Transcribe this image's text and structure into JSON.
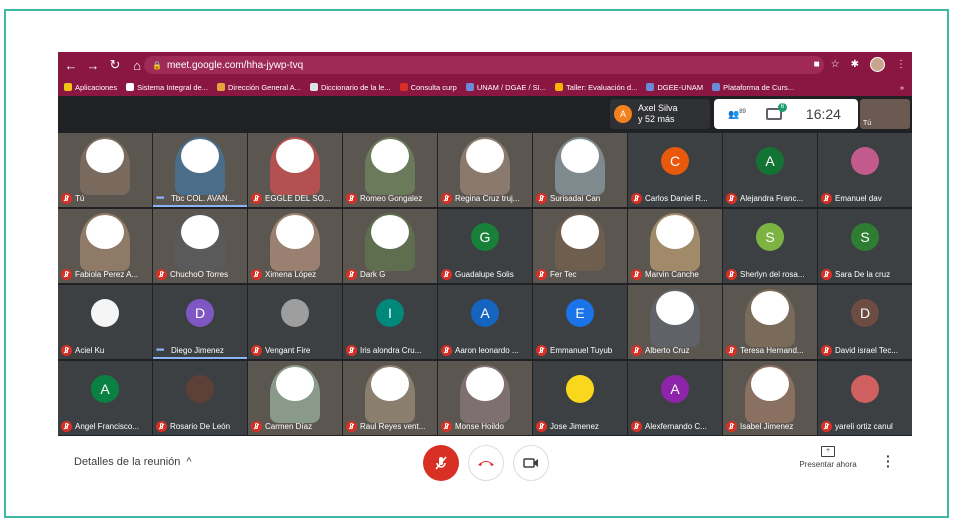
{
  "browser": {
    "url": "meet.google.com/hha-jywp-tvq",
    "bookmarks": [
      {
        "label": "Aplicaciones",
        "color": "#f0c419"
      },
      {
        "label": "Sistema Integral de...",
        "color": "#ffffff"
      },
      {
        "label": "Dirección General A...",
        "color": "#e8a33d"
      },
      {
        "label": "Diccionario de la le...",
        "color": "#e0e0e0"
      },
      {
        "label": "Consulta curp",
        "color": "#d93025"
      },
      {
        "label": "UNAM / DGAE / SI...",
        "color": "#6b8bd6"
      },
      {
        "label": "Taller: Evaluación d...",
        "color": "#f7b500"
      },
      {
        "label": "DGEE-UNAM",
        "color": "#6b8bd6"
      },
      {
        "label": "Plataforma de Curs...",
        "color": "#6b8bd6"
      }
    ],
    "more": "»"
  },
  "meet": {
    "host_avatar": "A",
    "host_name": "Axel Silva",
    "host_more": "y 52 más",
    "people_count": "89",
    "chat_badge": "6",
    "time": "16:24",
    "self_label": "Tú"
  },
  "participants": [
    {
      "name": "Tú",
      "kind": "video",
      "color": "#7a6a5e"
    },
    {
      "name": "Tbc COL. AVAN...",
      "kind": "video",
      "color": "#4a6e8a",
      "speaking": true
    },
    {
      "name": "EGGLE DEL SO...",
      "kind": "video",
      "color": "#b35050"
    },
    {
      "name": "Romeo Gongalez",
      "kind": "video",
      "color": "#6a7a5a"
    },
    {
      "name": "Regina Cruz truj...",
      "kind": "video",
      "color": "#8a7a6e"
    },
    {
      "name": "Surisadai Can",
      "kind": "video",
      "color": "#7e8a8e"
    },
    {
      "name": "Carlos Daniel R...",
      "kind": "initial",
      "initial": "C",
      "color": "#e8590c"
    },
    {
      "name": "Alejandra Franc...",
      "kind": "initial",
      "initial": "A",
      "color": "#137333"
    },
    {
      "name": "Emanuel dav",
      "kind": "pic",
      "color": "#c25a8c"
    },
    {
      "name": "Fabiola Perez A...",
      "kind": "video",
      "color": "#8e7a66"
    },
    {
      "name": "ChuchoO Torres",
      "kind": "video",
      "color": "#5a5a5a"
    },
    {
      "name": "Ximena López",
      "kind": "video",
      "color": "#9a8070"
    },
    {
      "name": "Dark G",
      "kind": "video",
      "color": "#5e6e4e"
    },
    {
      "name": "Guadalupe Solis",
      "kind": "initial",
      "initial": "G",
      "color": "#188038"
    },
    {
      "name": "Fer Tec",
      "kind": "video",
      "color": "#6e5e4e"
    },
    {
      "name": "Marvin Canche",
      "kind": "video",
      "color": "#a08a6a"
    },
    {
      "name": "Sherlyn del rosa...",
      "kind": "initial",
      "initial": "S",
      "color": "#7cb342"
    },
    {
      "name": "Sara De la cruz",
      "kind": "initial",
      "initial": "S",
      "color": "#2e7d32"
    },
    {
      "name": "Aciel Ku",
      "kind": "pic",
      "color": "#f5f5f5"
    },
    {
      "name": "Diego Jimenez",
      "kind": "initial",
      "initial": "D",
      "color": "#7e57c2",
      "speaking": true
    },
    {
      "name": "Vengant Fire",
      "kind": "pic",
      "color": "#9e9e9e"
    },
    {
      "name": "Iris alondra Cru...",
      "kind": "initial",
      "initial": "I",
      "color": "#00897b"
    },
    {
      "name": "Aaron leonardo ...",
      "kind": "initial",
      "initial": "A",
      "color": "#1565c0"
    },
    {
      "name": "Emmanuel Tuyub",
      "kind": "initial",
      "initial": "E",
      "color": "#1a73e8"
    },
    {
      "name": "Alberto Cruz",
      "kind": "video",
      "color": "#5f6368"
    },
    {
      "name": "Teresa Hernand...",
      "kind": "video",
      "color": "#7a6a5a"
    },
    {
      "name": "David israel Tec...",
      "kind": "initial",
      "initial": "D",
      "color": "#6d4c41"
    },
    {
      "name": "Angel Francisco...",
      "kind": "initial",
      "initial": "A",
      "color": "#0b8043"
    },
    {
      "name": "Rosario De León",
      "kind": "pic",
      "color": "#5d4037"
    },
    {
      "name": "Carmen Díaz",
      "kind": "video",
      "color": "#8a9a8a"
    },
    {
      "name": "Raul Reyes vent...",
      "kind": "video",
      "color": "#8a7e6e"
    },
    {
      "name": "Monse Hoildo",
      "kind": "video",
      "color": "#7e7070"
    },
    {
      "name": "Jose Jimenez",
      "kind": "pic",
      "color": "#f9d71c"
    },
    {
      "name": "Alexfernando C...",
      "kind": "initial",
      "initial": "A",
      "color": "#8e24aa"
    },
    {
      "name": "Isabel Jimenez",
      "kind": "video",
      "color": "#8a7060"
    },
    {
      "name": "yareli ortiz canul",
      "kind": "pic",
      "color": "#d06060"
    }
  ],
  "bottom": {
    "details_label": "Detalles de la reunión",
    "present_label": "Presentar ahora"
  }
}
